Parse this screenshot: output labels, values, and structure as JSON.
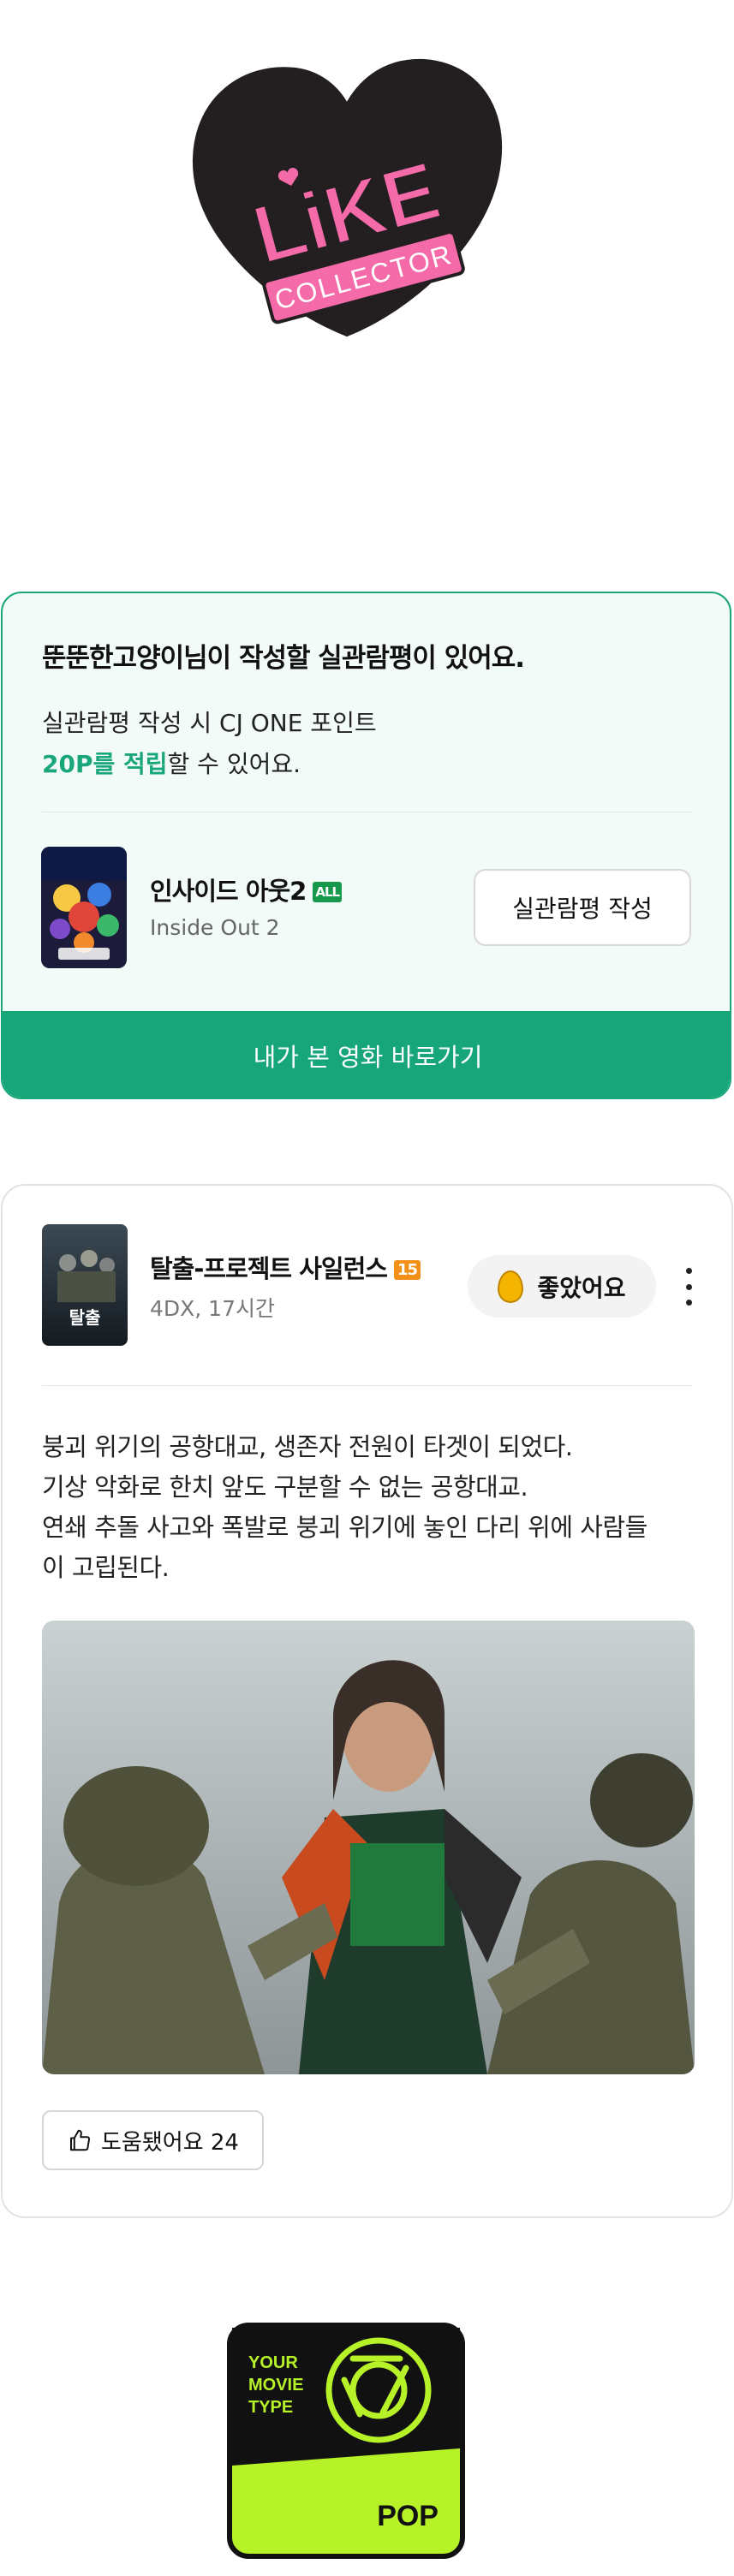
{
  "badge": {
    "like_text": "LiKE",
    "collector_text": "COLLECTOR"
  },
  "review_prompt": {
    "title": "뚠뚠한고양이님이 작성할 실관람평이 있어요.",
    "desc_line1": "실관람평 작성 시 CJ ONE 포인트",
    "desc_highlight": "20P를 적립",
    "desc_tail": "할 수 있어요.",
    "movie": {
      "title": "인사이드 아웃2",
      "rating": "ALL",
      "subtitle": "Inside Out 2"
    },
    "write_button": "실관람평 작성",
    "goto_button": "내가 본 영화 바로가기"
  },
  "review": {
    "movie_title": "탈출-프로젝트 사일런스",
    "rating": "15",
    "meta": "4DX, 17시간",
    "like_label": "좋았어요",
    "body": [
      "붕괴 위기의 공항대교, 생존자 전원이 타겟이 되었다.",
      "기상 악화로 한치 앞도 구분할 수 없는 공항대교.",
      "연쇄 추돌 사고와 폭발로 붕괴 위기에 놓인 다리 위에 사람들",
      "이 고립된다."
    ],
    "poster_text": "탈출",
    "helpful_label": "도움됐어요 24"
  },
  "type_badge": {
    "line1": "YOUR",
    "line2": "MOVIE",
    "line3": "TYPE",
    "type": "POP"
  },
  "colors": {
    "accent_green": "#19a67a",
    "badge_pink": "#f56aa8",
    "badge_dark": "#231f20",
    "type_lime": "#b6f227"
  },
  "icons": [
    "heart-icon",
    "egg-icon",
    "more-vertical-icon",
    "thumbs-up-icon",
    "aperture-icon"
  ]
}
